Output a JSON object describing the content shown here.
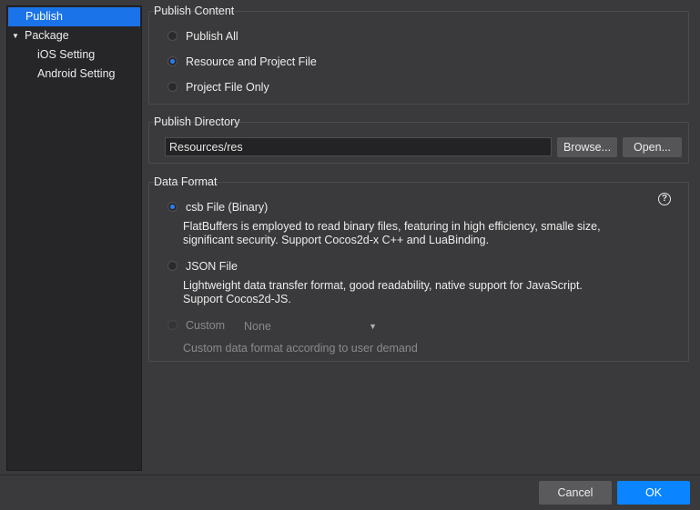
{
  "sidebar": {
    "items": [
      {
        "label": "Publish",
        "selected": true
      },
      {
        "label": "Package",
        "expanded": true
      },
      {
        "label": "iOS Setting"
      },
      {
        "label": "Android Setting"
      }
    ]
  },
  "publish_content": {
    "title": "Publish Content",
    "options": [
      {
        "label": "Publish All",
        "selected": false
      },
      {
        "label": "Resource and Project File",
        "selected": true
      },
      {
        "label": "Project File Only",
        "selected": false
      }
    ]
  },
  "publish_directory": {
    "title": "Publish Directory",
    "value": "Resources/res",
    "browse_label": "Browse...",
    "open_label": "Open..."
  },
  "data_format": {
    "title": "Data Format",
    "help_glyph": "?",
    "csb": {
      "label": "csb File (Binary)",
      "selected": true,
      "desc_line1": "FlatBuffers is employed to read binary files, featuring in high efficiency, smalle size,",
      "desc_line2": "significant security. Support Cocos2d-x C++ and LuaBinding."
    },
    "json": {
      "label": "JSON File",
      "selected": false,
      "desc_line1": "Lightweight data transfer format, good readability, native support for JavaScript.",
      "desc_line2": "Support Cocos2d-JS."
    },
    "custom": {
      "label": "Custom",
      "selected": false,
      "enabled": false,
      "select_value": "None",
      "desc": "Custom data format according to user demand"
    }
  },
  "footer": {
    "cancel_label": "Cancel",
    "ok_label": "OK"
  },
  "colors": {
    "accent": "#0a84ff",
    "selection": "#1a73e8",
    "background": "#3a3a3c",
    "sidebar_bg": "#262628"
  }
}
